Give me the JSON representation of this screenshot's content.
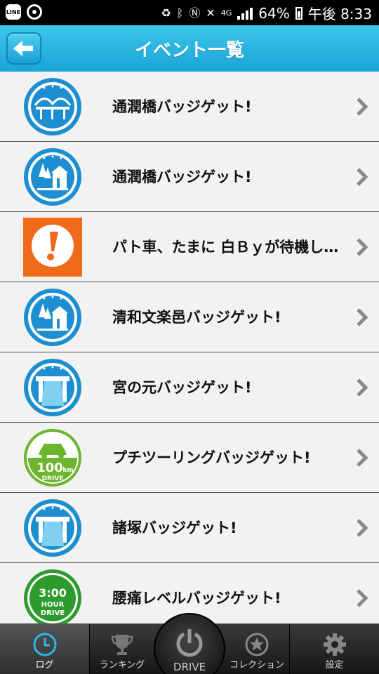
{
  "status_bar": {
    "line_label": "LINE",
    "network": "4G",
    "battery": "64%",
    "time": "午後 8:33"
  },
  "header": {
    "title": "イベント一覧"
  },
  "events": [
    {
      "label": "通潤橋バッジゲット!",
      "icon": "bridge-badge-icon"
    },
    {
      "label": "通潤橋バッジゲット!",
      "icon": "building-badge-icon"
    },
    {
      "label": "パト車、たまに 白Ｂｙが待機し…",
      "icon": "warning-exclamation-icon"
    },
    {
      "label": "清和文楽邑バッジゲット!",
      "icon": "building-badge-icon"
    },
    {
      "label": "宮の元バッジゲット!",
      "icon": "road-badge-icon"
    },
    {
      "label": "プチツーリングバッジゲット!",
      "icon": "100km-drive-badge-icon"
    },
    {
      "label": "諸塚バッジゲット!",
      "icon": "road-badge-icon"
    },
    {
      "label": "腰痛レベルバッジゲット!",
      "icon": "3hour-drive-badge-icon"
    }
  ],
  "badge_text": {
    "km100": "100",
    "km_unit": "km",
    "drive": "DRIVE",
    "hour_time": "3:00",
    "hour": "HOUR",
    "hour_drive": "DRIVE"
  },
  "bottom_nav": {
    "log": "ログ",
    "ranking": "ランキング",
    "drive": "DRIVE",
    "collection": "コレクション",
    "settings": "設定"
  },
  "colors": {
    "header_blue": "#1ba3d6",
    "badge_blue": "#1d8fd0",
    "warning_orange": "#f06a1b",
    "badge_green": "#6cb52d"
  }
}
